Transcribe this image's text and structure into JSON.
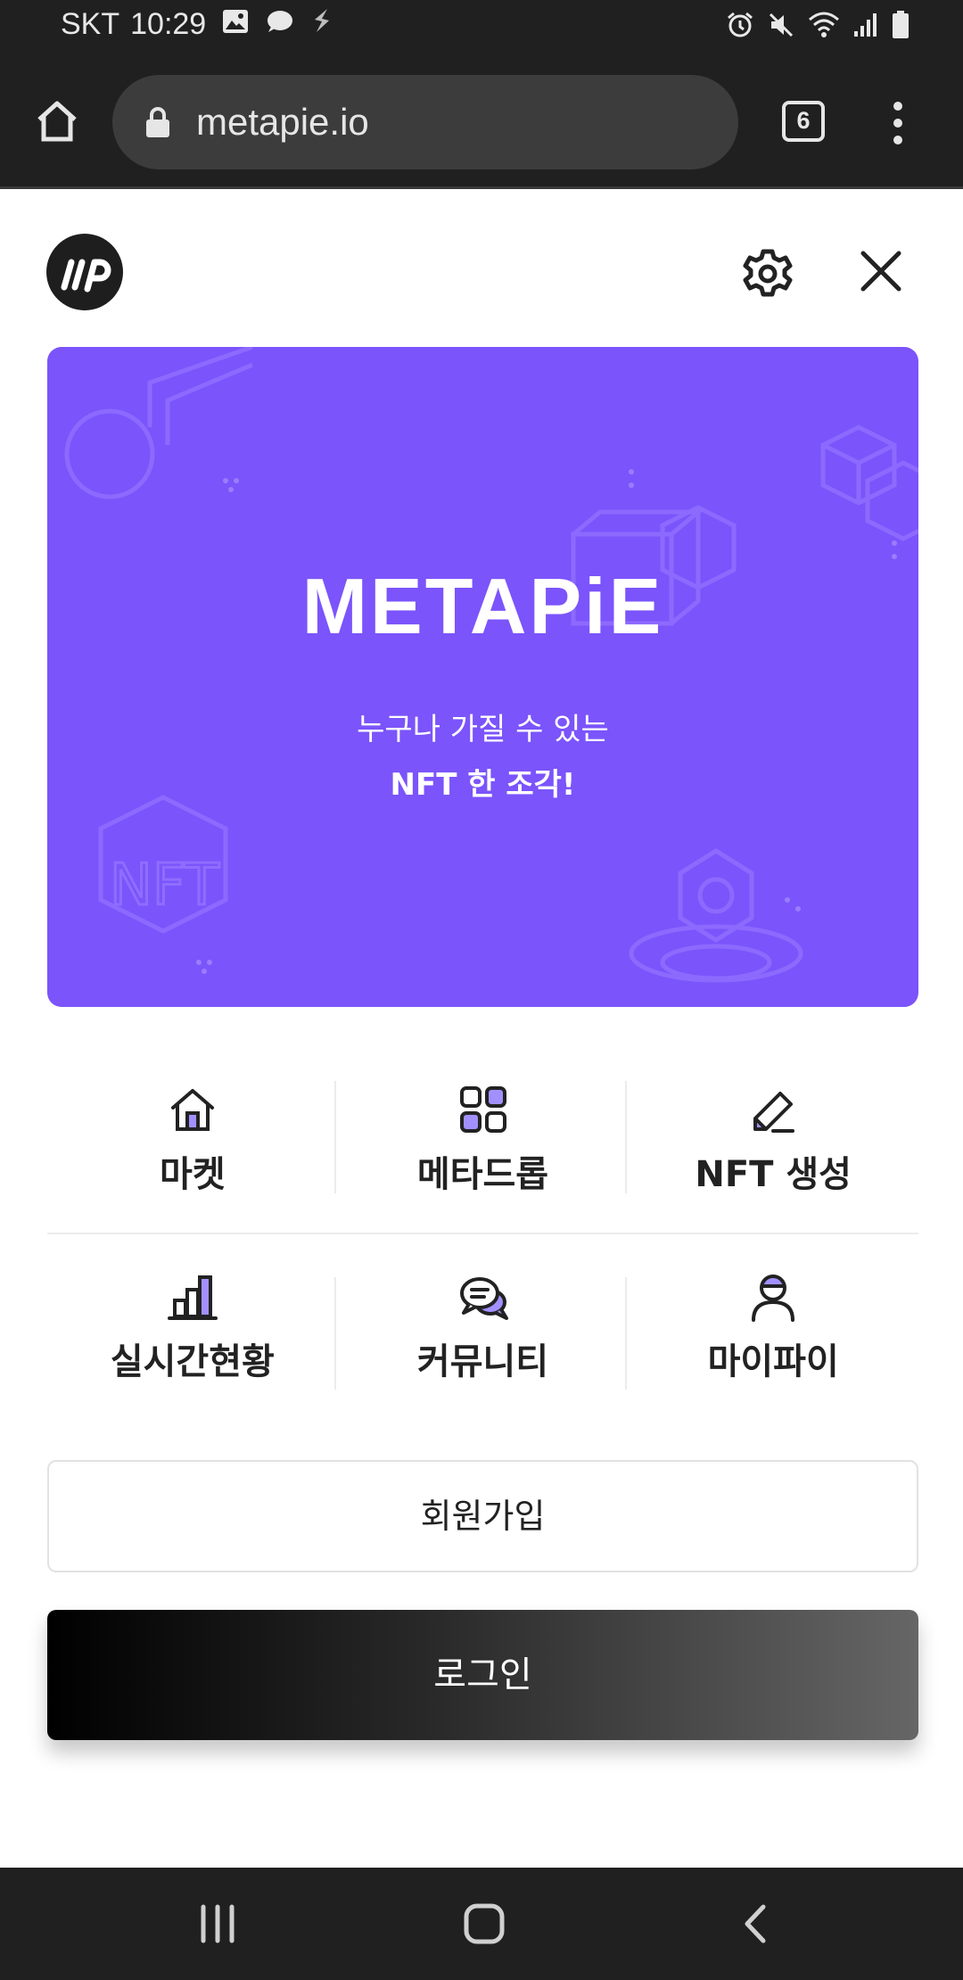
{
  "status_bar": {
    "carrier": "SKT",
    "time": "10:29",
    "left_icons": [
      "image-icon",
      "chat-bubble-icon",
      "app-s-icon"
    ],
    "right_icons": [
      "alarm-icon",
      "mute-icon",
      "wifi-icon",
      "signal-icon",
      "battery-icon"
    ]
  },
  "browser": {
    "url": "metapie.io",
    "tab_count": "6"
  },
  "header": {
    "logo_text": "mp",
    "icons": [
      "settings-icon",
      "close-icon"
    ]
  },
  "banner": {
    "brand": "METAPiE",
    "tagline_line1": "누구나 가질 수 있는",
    "tagline_line2": "NFT 한 조각!",
    "background_color": "#7b54fb"
  },
  "menu": {
    "row1": [
      {
        "label": "마켓",
        "icon": "home-icon"
      },
      {
        "label": "메타드롭",
        "icon": "grid-icon"
      },
      {
        "label": "NFT 생성",
        "icon": "pencil-icon"
      }
    ],
    "row2": [
      {
        "label": "실시간현황",
        "icon": "bar-chart-icon"
      },
      {
        "label": "커뮤니티",
        "icon": "chat-icon"
      },
      {
        "label": "마이파이",
        "icon": "user-icon"
      }
    ],
    "accent_color": "#a390ff"
  },
  "buttons": {
    "signup": "회원가입",
    "login": "로그인"
  },
  "nav_bar": {
    "icons": [
      "recent-apps-icon",
      "home-icon",
      "back-icon"
    ]
  }
}
